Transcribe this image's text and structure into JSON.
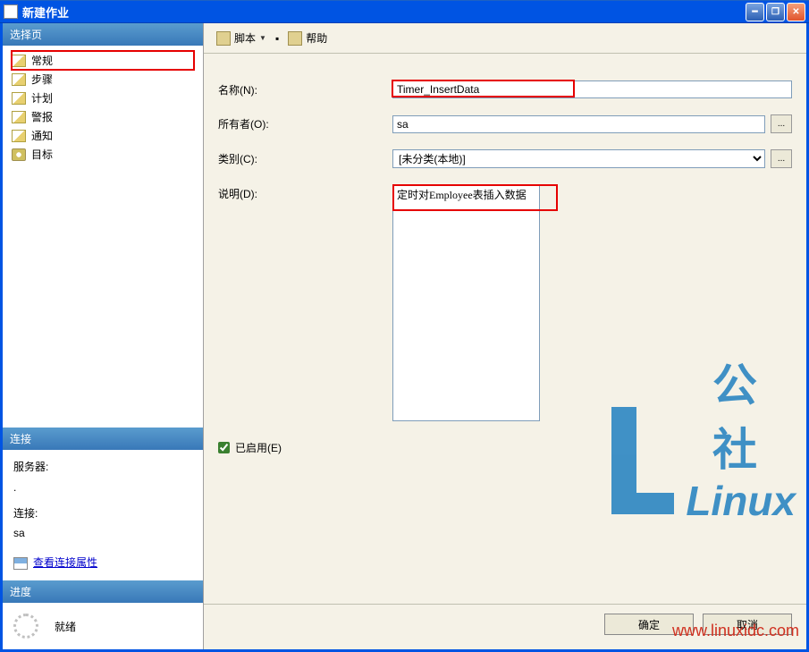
{
  "window": {
    "title": "新建作业"
  },
  "sidebar": {
    "select_page_header": "选择页",
    "nav": [
      {
        "label": "常规",
        "highlighted": true
      },
      {
        "label": "步骤",
        "highlighted": false
      },
      {
        "label": "计划",
        "highlighted": false
      },
      {
        "label": "警报",
        "highlighted": false
      },
      {
        "label": "通知",
        "highlighted": false
      },
      {
        "label": "目标",
        "highlighted": false
      }
    ],
    "connection_header": "连接",
    "server_label": "服务器:",
    "server_value": ".",
    "conn_label": "连接:",
    "conn_value": "sa",
    "view_props_link": "查看连接属性",
    "progress_header": "进度",
    "progress_status": "就绪"
  },
  "toolbar": {
    "script_label": "脚本",
    "help_label": "帮助"
  },
  "form": {
    "name_label": "名称(N):",
    "name_value": "Timer_InsertData",
    "owner_label": "所有者(O):",
    "owner_value": "sa",
    "category_label": "类别(C):",
    "category_value": "[未分类(本地)]",
    "description_label": "说明(D):",
    "description_value": "定时对Employee表插入数据",
    "enabled_label": "已启用(E)",
    "enabled_checked": true
  },
  "buttons": {
    "ok": "确定",
    "cancel": "取消"
  },
  "watermark": {
    "cn": "公社",
    "en": "Linux",
    "url": "www.linuxidc.com"
  }
}
